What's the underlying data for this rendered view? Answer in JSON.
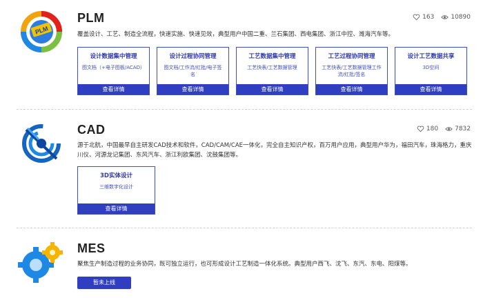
{
  "products": [
    {
      "title": "PLM",
      "likes": "163",
      "views": "10890",
      "description": "覆盖设计、工艺、制造全流程，快速实施、快速见效，典型用户中国二重、兰石集团、西电集团、浙江中控、潍海汽车等。",
      "logo_icon": "plm-logo-icon",
      "cards": [
        {
          "title": "设计数据集中管理",
          "sub": "图文档（+电子图板/ACAD）",
          "button": "查看详情"
        },
        {
          "title": "设计过程协同管理",
          "sub": "图文档/工作流/红批/电子签名",
          "button": "查看详情"
        },
        {
          "title": "工艺数据集中管理",
          "sub": "工艺快表/工艺数据管理",
          "button": "查看详情"
        },
        {
          "title": "工艺过程协同管理",
          "sub": "工艺快表/工艺数据管理工作流/红批/签名",
          "button": "查看详情"
        },
        {
          "title": "设计工艺数据共享",
          "sub": "3D空间",
          "button": "查看详情"
        }
      ]
    },
    {
      "title": "CAD",
      "likes": "180",
      "views": "7832",
      "description": "源于北航，中国最早自主研发CAD技术和软件，CAD/CAM/CAE一体化，完全自主知识产权，百万用户应用，典型用户华为，福田汽车，珠海格力，重庆川仪、河源龙记集团、东风汽车、浙江利欧集团、沈鼓集团等。",
      "logo_icon": "cad-logo-icon",
      "cards": [
        {
          "title": "3D实体设计",
          "sub": "三维数字化设计",
          "button": "查看详情"
        }
      ]
    },
    {
      "title": "MES",
      "description": "聚焦生产制造过程的业务协同，既可独立运行，也可形成设计工艺制造一体化系统。典型用户西飞、沈飞、东汽、东电、阳煤等。",
      "logo_icon": "mes-logo-icon",
      "button": "暂未上线"
    }
  ],
  "colors": {
    "accent": "#2f3fbf",
    "border": "#3f4fc0"
  }
}
